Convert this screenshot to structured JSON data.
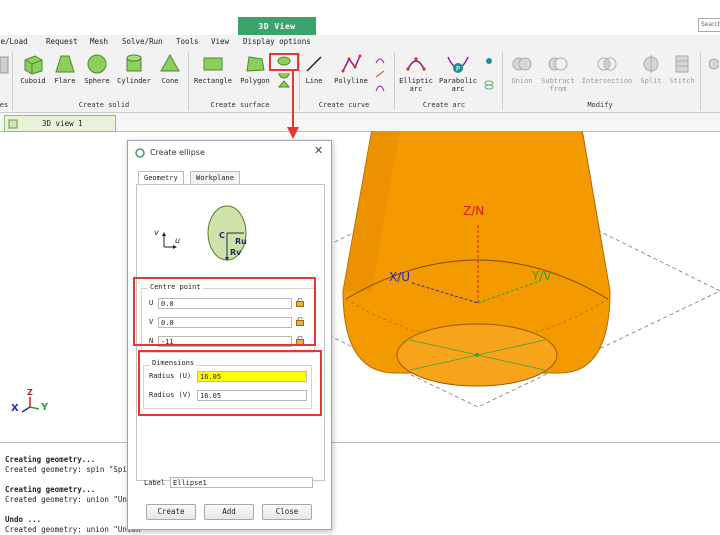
{
  "context_tab": "3D View",
  "search_placeholder": "Search",
  "menu": [
    "ce/Load",
    "Request",
    "Mesh",
    "Solve/Run",
    "Tools",
    "View",
    "Display options"
  ],
  "ribbon": {
    "groups": [
      "es",
      "Create solid",
      "Create surface",
      "Create curve",
      "Create arc",
      "Modify"
    ],
    "solid_tools": [
      "Cuboid",
      "Flare",
      "Sphere",
      "Cylinder",
      "Cone"
    ],
    "surface_tools": [
      "Rectangle",
      "Polygon"
    ],
    "curve_tools": [
      "Line",
      "Polyline"
    ],
    "arc_tools": [
      {
        "l1": "Elliptic",
        "l2": "arc"
      },
      {
        "l1": "Parabolic",
        "l2": "arc"
      }
    ],
    "modify_tools": [
      {
        "l1": "Union",
        "l2": ""
      },
      {
        "l1": "Subtract",
        "l2": "from"
      },
      {
        "l1": "Intersection",
        "l2": ""
      },
      {
        "l1": "Split",
        "l2": ""
      },
      {
        "l1": "Stitch",
        "l2": ""
      }
    ]
  },
  "view_tab": "3D view 1",
  "viewport": {
    "axis_z": "Z/N",
    "axis_x": "X/U",
    "axis_y": "Y/V",
    "triad_z": "Z",
    "triad_x": "X",
    "triad_y": "Y"
  },
  "dialog": {
    "title": "Create ellipse",
    "tabs": [
      "Geometry",
      "Workplane"
    ],
    "diagram": {
      "v": "v",
      "u": "u",
      "c": "C",
      "ru": "Ru",
      "rv": "Rv"
    },
    "centre": {
      "legend": "Centre point",
      "u_label": "U",
      "u_value": "0.0",
      "v_label": "V",
      "v_value": "0.0",
      "n_label": "N",
      "n_value": "-11"
    },
    "dimensions": {
      "legend": "Dimensions",
      "ru_label": "Radius (U)",
      "ru_value": "16.05",
      "rv_label": "Radius (V)",
      "rv_value": "16.05"
    },
    "label_label": "Label",
    "label_value": "Ellipse1",
    "buttons": [
      "Create",
      "Add",
      "Close"
    ]
  },
  "console": [
    {
      "text": "Creating geometry...",
      "bold": true
    },
    {
      "text": "Created geometry: spin \"Spin",
      "bold": false
    },
    {
      "text": "Creating geometry...",
      "bold": true
    },
    {
      "text": "Created geometry: union \"Uni",
      "bold": false
    },
    {
      "text": "Undo ...",
      "bold": true
    },
    {
      "text": "Created geometry: union \"Union",
      "bold": false
    }
  ],
  "colors": {
    "highlight": "#e53535",
    "accent_green": "#3aa26b",
    "cylinder": "#f39a00",
    "yellow_field": "#ffff00"
  }
}
